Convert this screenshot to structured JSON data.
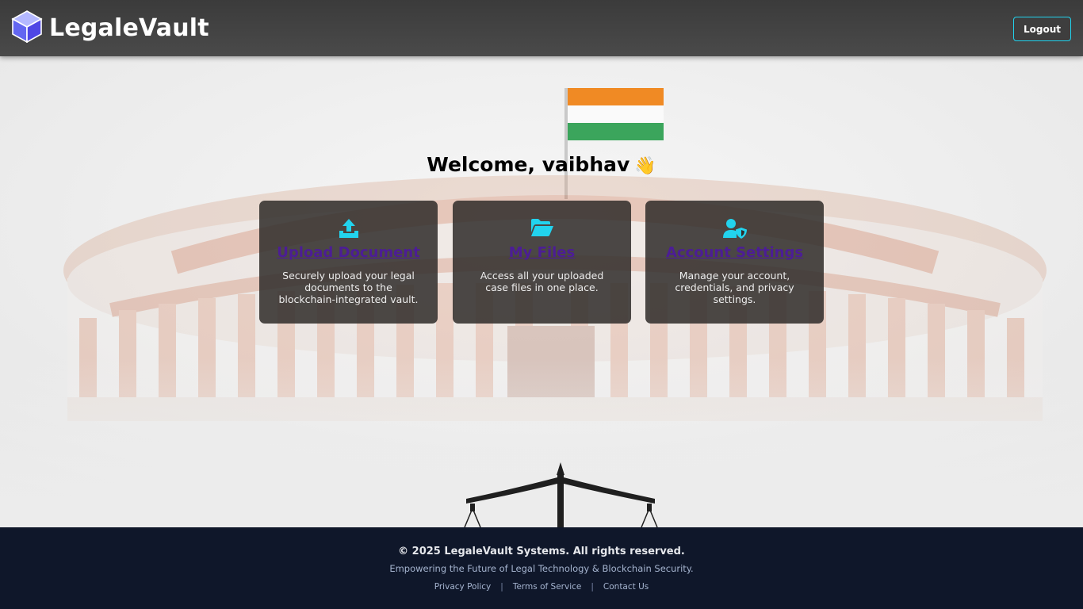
{
  "header": {
    "brand": "LegaleVault",
    "logo_icon": "cube-icon",
    "logout_label": "Logout"
  },
  "main": {
    "welcome": "Welcome, vaibhav",
    "wave_emoji": "👋",
    "cards": [
      {
        "icon": "upload-icon",
        "title": "Upload Document",
        "description": "Securely upload your legal documents to the blockchain-integrated vault."
      },
      {
        "icon": "folder-open-icon",
        "title": "My Files",
        "description": "Access all your uploaded case files in one place."
      },
      {
        "icon": "user-shield-icon",
        "title": "Account Settings",
        "description": "Manage your account, credentials, and privacy settings."
      }
    ]
  },
  "footer": {
    "copyright": "© 2025 LegaleVault Systems. All rights reserved.",
    "tagline": "Empowering the Future of Legal Technology & Blockchain Security.",
    "links": [
      "Privacy Policy",
      "Terms of Service",
      "Contact Us"
    ],
    "separator": "|"
  },
  "colors": {
    "accent": "#22d3ee",
    "header_bg": "#444444",
    "footer_bg": "#0f172a",
    "card_link": "#4c1d95"
  }
}
